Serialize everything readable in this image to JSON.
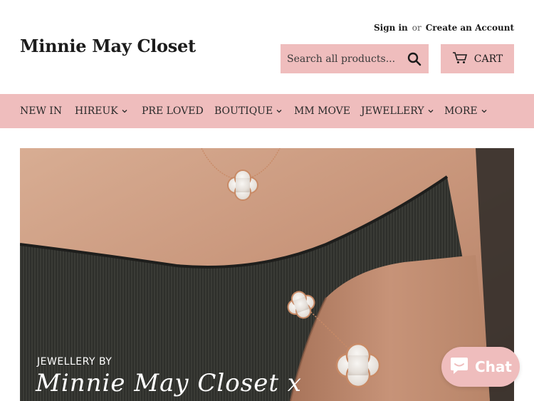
{
  "header": {
    "sign_in": "Sign in",
    "or": "or",
    "create_account": "Create an Account",
    "logo": "Minnie May Closet",
    "search_placeholder": "Search all products...",
    "cart_label": "CART"
  },
  "nav": {
    "items": [
      {
        "label": "NEW IN",
        "dropdown": false
      },
      {
        "label": "HIREUK",
        "dropdown": true
      },
      {
        "label": "PRE LOVED",
        "dropdown": false
      },
      {
        "label": "BOUTIQUE",
        "dropdown": true
      },
      {
        "label": "MM MOVE",
        "dropdown": false
      },
      {
        "label": "JEWELLERY",
        "dropdown": true
      },
      {
        "label": "MORE",
        "dropdown": true
      }
    ]
  },
  "hero": {
    "line1": "JEWELLERY BY",
    "line2": "Minnie May Closet x"
  },
  "chat": {
    "label": "Chat"
  },
  "colors": {
    "accent": "#efbdbd",
    "text": "#1c1c1c"
  }
}
